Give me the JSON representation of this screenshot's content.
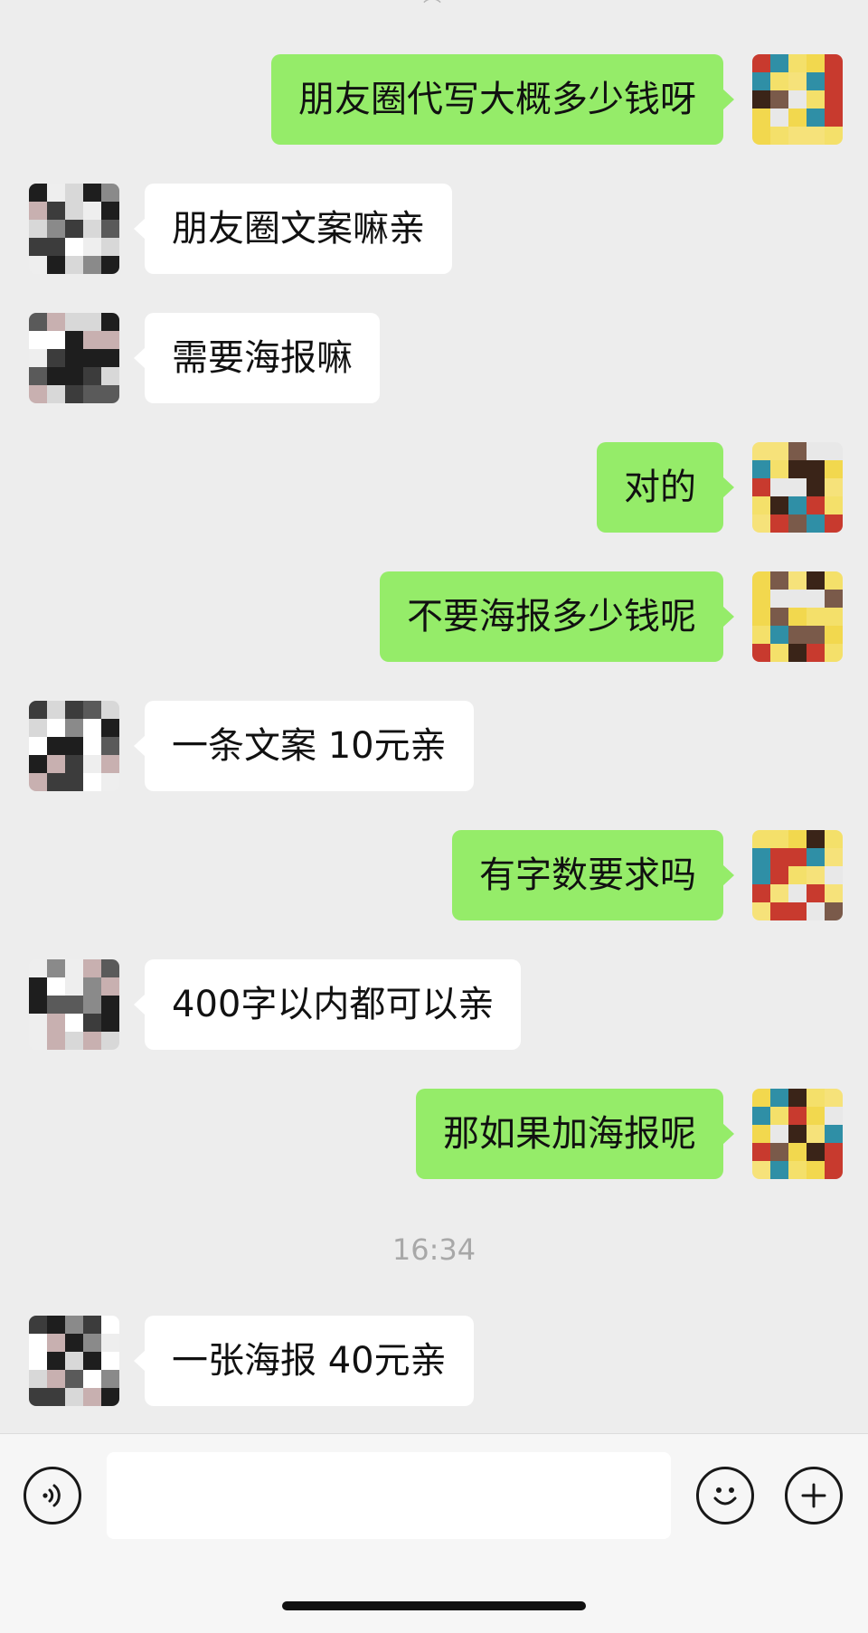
{
  "messages": [
    {
      "side": "right",
      "text": "朋友圈代写大概多少钱呀"
    },
    {
      "side": "left",
      "text": "朋友圈文案嘛亲"
    },
    {
      "side": "left",
      "text": "需要海报嘛"
    },
    {
      "side": "right",
      "text": "对的"
    },
    {
      "side": "right",
      "text": "不要海报多少钱呢"
    },
    {
      "side": "left",
      "text": "一条文案 10元亲"
    },
    {
      "side": "right",
      "text": "有字数要求吗"
    },
    {
      "side": "left",
      "text": "400字以内都可以亲"
    },
    {
      "side": "right",
      "text": "那如果加海报呢"
    },
    {
      "side": "left",
      "text": "一张海报 40元亲"
    }
  ],
  "timestamp": "16:34",
  "input": {
    "value": "",
    "placeholder": ""
  },
  "icons": {
    "voice": "voice-icon",
    "emoji": "emoji-icon",
    "plus": "plus-icon"
  },
  "colors": {
    "sent_bubble": "#95ec69",
    "received_bubble": "#ffffff",
    "background": "#ededed"
  }
}
